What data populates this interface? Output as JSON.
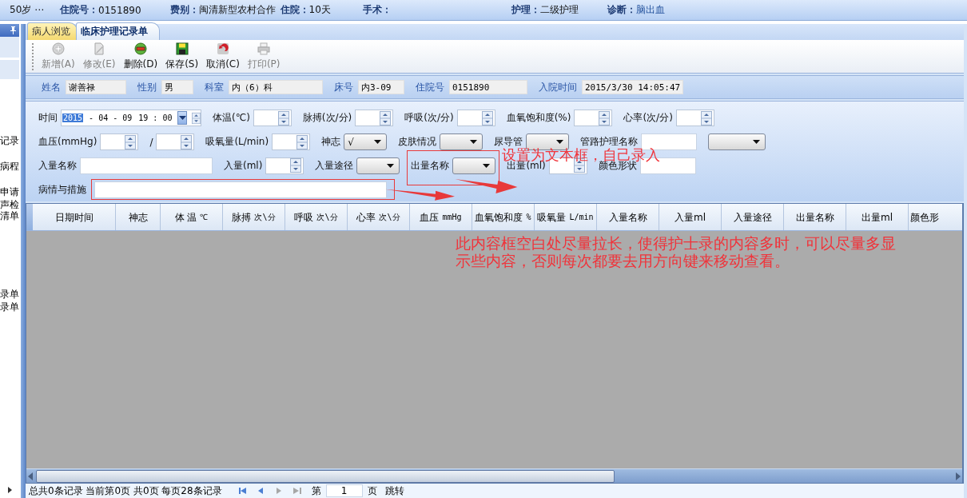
{
  "info_bar": [
    {
      "value": "50岁 ⋯"
    },
    {
      "label": "住院号：",
      "value": "0151890"
    },
    {
      "label": "费别：",
      "value": "闽清新型农村合作"
    },
    {
      "label": "住院：",
      "value": "10天"
    },
    {
      "label": "手术："
    },
    {
      "label": "护理：",
      "value": "二级护理"
    },
    {
      "label": "诊断：",
      "value": "脑出血"
    }
  ],
  "sidebar": {
    "items": [
      "记录",
      "病程",
      "申请",
      "声检",
      "清单",
      "录单",
      "录单"
    ]
  },
  "tabs": [
    {
      "label": "病人浏览",
      "selected": false
    },
    {
      "label": "临床护理记录单",
      "selected": true
    }
  ],
  "toolbar": [
    {
      "label": "新增(A)",
      "disabled": true
    },
    {
      "label": "修改(E)",
      "disabled": true
    },
    {
      "label": "删除(D)",
      "disabled": false
    },
    {
      "label": "保存(S)",
      "disabled": false
    },
    {
      "label": "取消(C)",
      "disabled": false
    },
    {
      "label": "打印(P)",
      "disabled": true
    }
  ],
  "patient": [
    {
      "label": "姓名",
      "value": "谢善禄"
    },
    {
      "label": "性别",
      "value": "男"
    },
    {
      "label": "科室",
      "value": "内（6）科"
    },
    {
      "label": "床号",
      "value": "内3-09"
    },
    {
      "label": "住院号",
      "value": "0151890"
    },
    {
      "label": "入院时间",
      "value": "2015/3/30 14:05:47"
    }
  ],
  "form": {
    "rows": [
      {
        "fields": [
          {
            "label": "时间",
            "kind": "datetime",
            "segments": [
              {
                "text": "2015",
                "selected": true
              },
              {
                "text": "- 04 - 09",
                "selected": false
              },
              {
                "text": "19 : 00",
                "selected": false
              }
            ]
          },
          {
            "label": "体温(℃)",
            "kind": "spin"
          },
          {
            "label": "脉搏(次/分)",
            "kind": "spin"
          },
          {
            "label": "呼吸(次/分)",
            "kind": "spin"
          },
          {
            "label": "血氧饱和度(%)",
            "kind": "spin"
          },
          {
            "label": "心率(次/分)",
            "kind": "spin"
          }
        ]
      },
      {
        "fields": [
          {
            "label": "血压(mmHg)",
            "kind": "spin"
          },
          {
            "label": "/",
            "kind": "spin"
          },
          {
            "label": "吸氧量(L/min)",
            "kind": "spin"
          },
          {
            "label": "神志",
            "kind": "combo",
            "value": "√"
          },
          {
            "label": "皮肤情况",
            "kind": "combo"
          },
          {
            "label": "尿导管",
            "kind": "combo"
          },
          {
            "label": "管路护理名称",
            "kind": "text"
          },
          {
            "kind": "combo"
          }
        ]
      },
      {
        "fields": [
          {
            "label": "入量名称",
            "kind": "longtext"
          },
          {
            "label": "入量(ml)",
            "kind": "spin"
          },
          {
            "label": "入量途径",
            "kind": "combo"
          },
          {
            "label": "出量名称",
            "kind": "combo"
          },
          {
            "label": "出量(ml)",
            "kind": "spin"
          },
          {
            "label": "颜色形状",
            "kind": "text"
          }
        ]
      },
      {
        "fields": [
          {
            "label": "病情与措施",
            "kind": "memo"
          }
        ]
      }
    ]
  },
  "grid": {
    "columns": [
      {
        "label": "日期时间"
      },
      {
        "label": "神志"
      },
      {
        "label": "体 温",
        "unit": "℃"
      },
      {
        "label": "脉搏",
        "unit": "次\\分"
      },
      {
        "label": "呼吸",
        "unit": "次\\分"
      },
      {
        "label": "心率",
        "unit": "次\\分"
      },
      {
        "label": "血压",
        "unit": "mmHg"
      },
      {
        "label": "血氧饱和度",
        "unit": "%"
      },
      {
        "label": "吸氧量",
        "unit": "L/min"
      },
      {
        "label": "入量名称"
      },
      {
        "label": "入量ml"
      },
      {
        "label": "入量途径"
      },
      {
        "label": "出量名称"
      },
      {
        "label": "出量ml"
      },
      {
        "label": "颜色形"
      }
    ]
  },
  "pager": {
    "summary": "总共0条记录 当前第0页 共0页 每页28条记录",
    "page_prefix": "第",
    "page": "1",
    "page_suffix": "页",
    "jump": "跳转"
  },
  "annotations": [
    {
      "text": "设置为文本框，自己录入"
    },
    {
      "text": "此内容框空白处尽量拉长，使得护士录的内容多时，可以尽量多显示些内容，否则每次都要去用方向键来移动查看。"
    }
  ]
}
